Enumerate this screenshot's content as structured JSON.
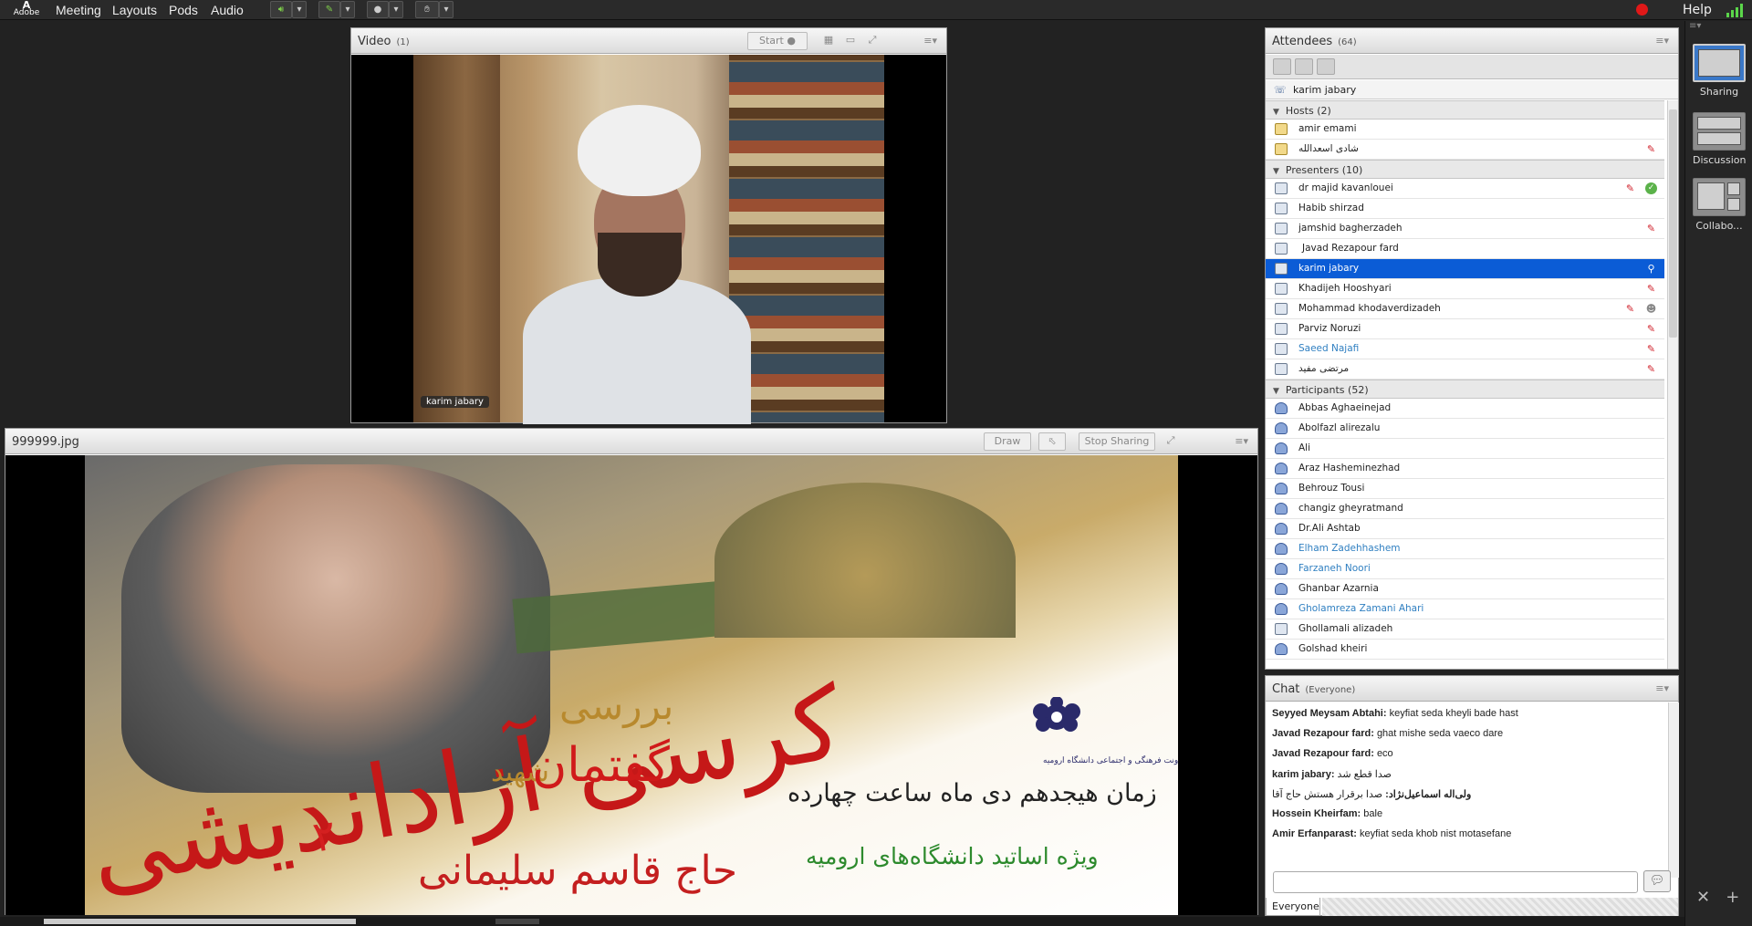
{
  "app": {
    "logo_label": "Adobe",
    "logo_mark": "A"
  },
  "menu": {
    "items": [
      "Meeting",
      "Layouts",
      "Pods",
      "Audio"
    ],
    "help": "Help"
  },
  "video": {
    "title": "Video",
    "count": "(1)",
    "start_label": "Start",
    "camera_label": "karim jabary"
  },
  "share": {
    "title": "999999.jpg",
    "draw_label": "Draw",
    "stop_label": "Stop Sharing",
    "slide_text": {
      "line_time": "زمان هیجدهم دی ماه ساعت چهارده",
      "line_for": "ویژه اساتید دانشگاه‌های ارومیه",
      "line_review": "بررسی",
      "line_discourse": "گفتمان",
      "line_name": "حاج قاسم سلیمانی",
      "line_martyr": "شهید",
      "line_big": "کرسی آزاداندیشی",
      "line_num": "۲",
      "logo_caption": "معاونت فرهنگی و اجتماعی دانشگاه ارومیه"
    }
  },
  "attendees": {
    "title": "Attendees",
    "count": "(64)",
    "self": "karim jabary",
    "groups": {
      "hosts": {
        "label": "Hosts (2)",
        "members": [
          {
            "name": "amir emami"
          },
          {
            "name": "شادی اسعدالله"
          }
        ]
      },
      "presenters": {
        "label": "Presenters (10)",
        "members": [
          {
            "name": "dr majid kavanlouei"
          },
          {
            "name": "Habib shirzad"
          },
          {
            "name": "jamshid bagherzadeh"
          },
          {
            "name": "Javad Rezapour fard"
          },
          {
            "name": "karim jabary"
          },
          {
            "name": "Khadijeh Hooshyari"
          },
          {
            "name": "Mohammad khodaverdizadeh"
          },
          {
            "name": "Parviz Noruzi"
          },
          {
            "name": "Saeed Najafi"
          },
          {
            "name": "مرتضی مفید"
          }
        ]
      },
      "participants": {
        "label": "Participants (52)",
        "members": [
          {
            "name": "Abbas Aghaeinejad"
          },
          {
            "name": "Abolfazl alirezalu"
          },
          {
            "name": "Ali"
          },
          {
            "name": "Araz Hasheminezhad"
          },
          {
            "name": "Behrouz Tousi"
          },
          {
            "name": "changiz gheyratmand"
          },
          {
            "name": "Dr.Ali Ashtab"
          },
          {
            "name": "Elham Zadehhashem"
          },
          {
            "name": "Farzaneh Noori"
          },
          {
            "name": "Ghanbar Azarnia"
          },
          {
            "name": "Gholamreza Zamani Ahari"
          },
          {
            "name": "Ghollamali alizadeh"
          },
          {
            "name": "Golshad kheiri"
          }
        ]
      }
    }
  },
  "chat": {
    "title": "Chat",
    "scope": "(Everyone)",
    "tab_label": "Everyone",
    "messages": [
      {
        "sender": "Seyyed Meysam Abtahi:",
        "text": "keyfiat seda kheyli bade hast"
      },
      {
        "sender": "Javad Rezapour fard:",
        "text": "ghat mishe seda vaeco dare"
      },
      {
        "sender": "Javad Rezapour fard:",
        "text": "eco"
      },
      {
        "sender": "karim jabary:",
        "text": "صدا قطع شد"
      },
      {
        "sender": "ولی‌اله اسماعیل‌نژاد:",
        "text": "صدا برقرار هستش حاج آقا"
      },
      {
        "sender": "Hossein Kheirfam:",
        "text": "bale"
      },
      {
        "sender": "Amir Erfanparast:",
        "text": "keyfiat seda khob nist motasefane"
      }
    ]
  },
  "layouts": {
    "items": [
      {
        "label": "Sharing",
        "active": true
      },
      {
        "label": "Discussion",
        "active": false
      },
      {
        "label": "Collabo...",
        "active": false
      }
    ]
  },
  "colors": {
    "selection": "#0b5cd6",
    "link_blue": "#2f7fc1",
    "mic_off_red": "#d0202a",
    "record_red": "#e01818",
    "signal_green": "#5bd64a"
  }
}
